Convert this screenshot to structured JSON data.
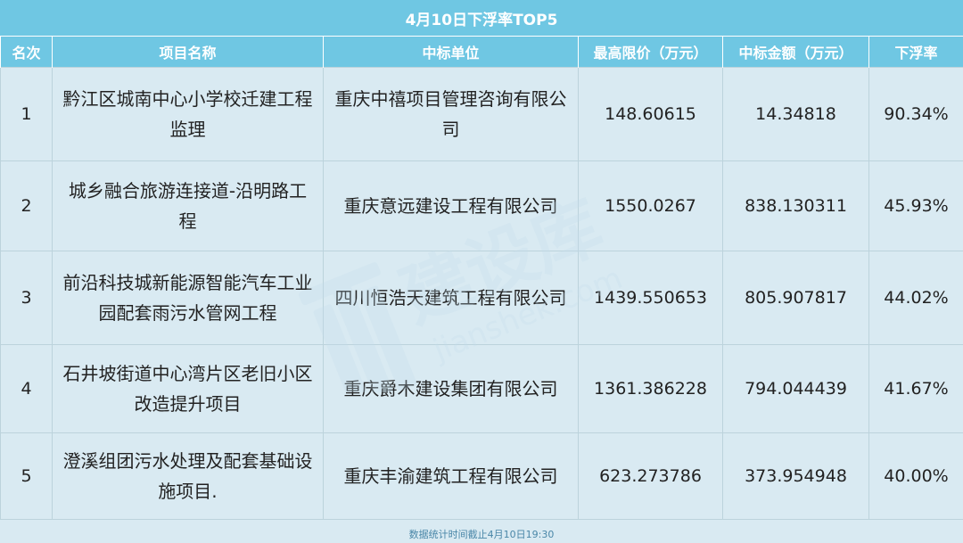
{
  "title": "4月10日下浮率TOP5",
  "headers": [
    "名次",
    "项目名称",
    "中标单位",
    "最高限价（万元）",
    "中标金额（万元）",
    "下浮率"
  ],
  "rows": [
    {
      "rank": "1",
      "project": "黔江区城南中心小学校迁建工程监理",
      "winner": "重庆中禧项目管理咨询有限公司",
      "max_price": "148.60615",
      "bid_amount": "14.34818",
      "discount": "90.34%"
    },
    {
      "rank": "2",
      "project": "城乡融合旅游连接道-沿明路工程",
      "winner": "重庆意远建设工程有限公司",
      "max_price": "1550.0267",
      "bid_amount": "838.130311",
      "discount": "45.93%"
    },
    {
      "rank": "3",
      "project": "前沿科技城新能源智能汽车工业园配套雨污水管网工程",
      "winner": "四川恒浩天建筑工程有限公司",
      "max_price": "1439.550653",
      "bid_amount": "805.907817",
      "discount": "44.02%"
    },
    {
      "rank": "4",
      "project": "石井坡街道中心湾片区老旧小区改造提升项目",
      "winner": "重庆爵木建设集团有限公司",
      "max_price": "1361.386228",
      "bid_amount": "794.044439",
      "discount": "41.67%"
    },
    {
      "rank": "5",
      "project": "澄溪组团污水处理及配套基础设施项目.",
      "winner": "重庆丰渝建筑工程有限公司",
      "max_price": "623.273786",
      "bid_amount": "373.954948",
      "discount": "40.00%"
    }
  ],
  "footer": "数据统计时间截止4月10日19:30",
  "watermark": {
    "brand": "建设库",
    "domain": "jianshek.com",
    "icon": "building-logo-icon"
  },
  "colors": {
    "header_bg": "#6fc7e3",
    "body_bg": "#d9eaf2",
    "text": "#222222",
    "footer_text": "#4a87a8",
    "watermark": "#c2dbe9"
  }
}
